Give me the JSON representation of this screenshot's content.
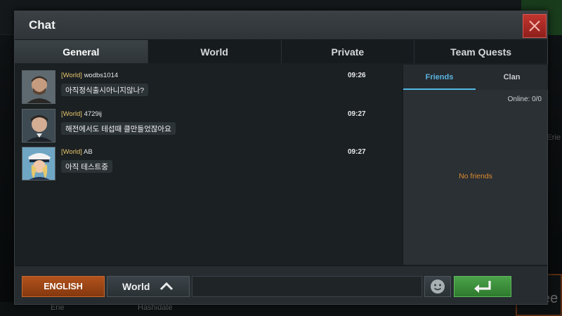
{
  "window": {
    "title": "Chat"
  },
  "tabs": [
    {
      "label": "General",
      "active": true
    },
    {
      "label": "World",
      "active": false
    },
    {
      "label": "Private",
      "active": false
    },
    {
      "label": "Team Quests",
      "active": false
    }
  ],
  "messages": [
    {
      "tag": "[World]",
      "user": "wodbs1014",
      "time": "09:26",
      "text": "아직정식출시아니지않나?"
    },
    {
      "tag": "[World]",
      "user": "4729ij",
      "time": "09:27",
      "text": "해전에서도 테섭때 클만들었잖아요"
    },
    {
      "tag": "[World]",
      "user": "AB",
      "time": "09:27",
      "text": "아직 테스트중"
    }
  ],
  "friends_panel": {
    "tabs": [
      {
        "label": "Friends",
        "active": true
      },
      {
        "label": "Clan",
        "active": false
      }
    ],
    "online": "Online: 0/0",
    "empty_text": "No friends"
  },
  "bottom": {
    "language": "ENGLISH",
    "channel": "World",
    "input_value": "",
    "input_placeholder": ""
  },
  "background": {
    "side_text": "Erie",
    "name1": "Erie",
    "name2": "Hashidate",
    "corner_text": "ee"
  },
  "colors": {
    "accent_blue": "#55b8e6",
    "tag_yellow": "#e3c46a",
    "orange_text": "#e08a30",
    "close_red": "#c0352e",
    "send_green": "#4ba24a",
    "lang_orange": "#b1521c"
  },
  "icons": {
    "close": "close-icon",
    "channel_toggle": "chevron-up-icon",
    "emoji": "smiley-icon",
    "send": "enter-arrow-icon"
  }
}
